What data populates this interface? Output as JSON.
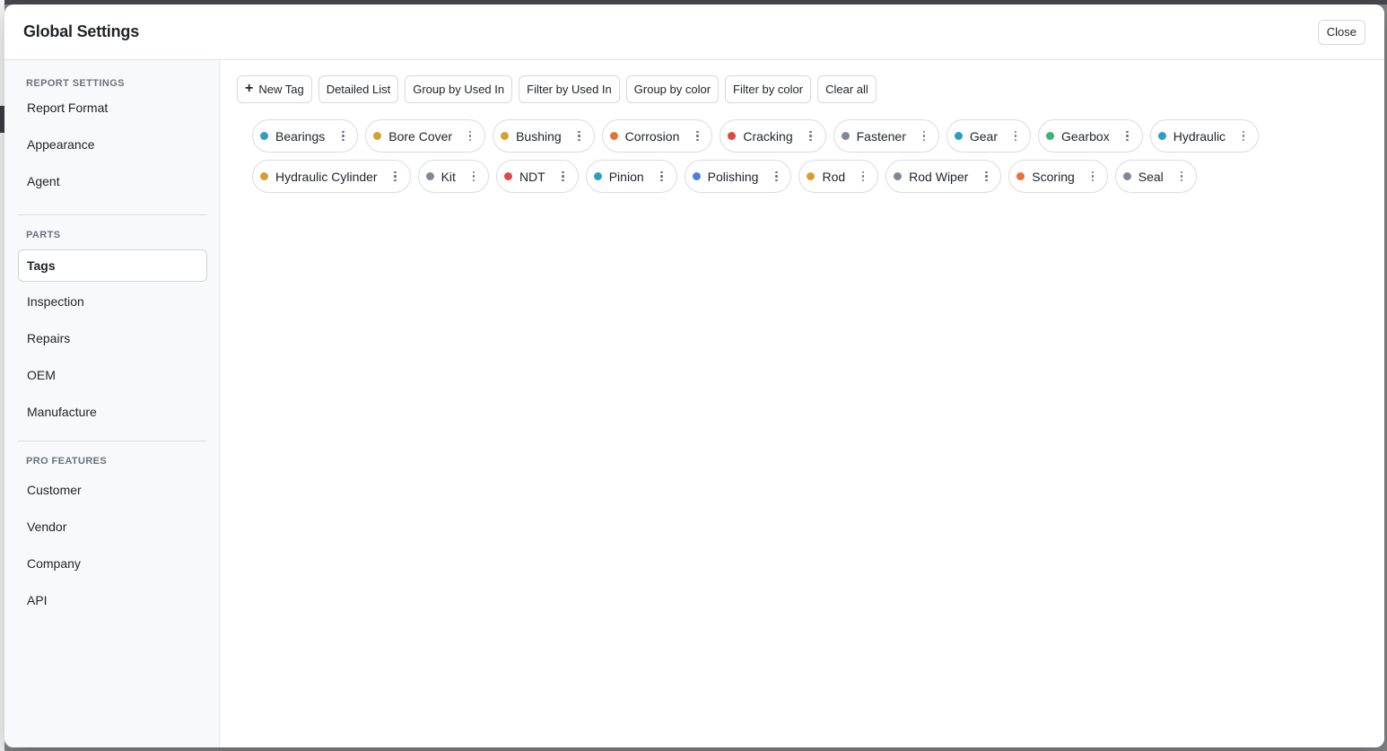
{
  "modal": {
    "title": "Global Settings",
    "close_label": "Close"
  },
  "sidebar": {
    "sections": [
      {
        "label": "REPORT SETTINGS",
        "items": [
          "Report Format",
          "Appearance",
          "Agent"
        ]
      },
      {
        "label": "PARTS",
        "items": [
          "Tags",
          "Inspection",
          "Repairs",
          "OEM",
          "Manufacture"
        ]
      },
      {
        "label": "PRO FEATURES",
        "items": [
          "Customer",
          "Vendor",
          "Company",
          "API"
        ]
      }
    ],
    "active_item": "Tags"
  },
  "toolbar": {
    "new_tag": "New Tag",
    "detailed_list": "Detailed List",
    "group_by_used_in": "Group by Used In",
    "filter_by_used_in": "Filter by Used In",
    "group_by_color": "Group by color",
    "filter_by_color": "Filter by color",
    "clear_all": "Clear all"
  },
  "tags": [
    {
      "label": "Bearings",
      "color": "#2e9fbd"
    },
    {
      "label": "Bore Cover",
      "color": "#d4a030"
    },
    {
      "label": "Bushing",
      "color": "#d4a030"
    },
    {
      "label": "Corrosion",
      "color": "#e8703a"
    },
    {
      "label": "Cracking",
      "color": "#e04848"
    },
    {
      "label": "Fastener",
      "color": "#808894"
    },
    {
      "label": "Gear",
      "color": "#2e9fbd"
    },
    {
      "label": "Gearbox",
      "color": "#3cb371"
    },
    {
      "label": "Hydraulic",
      "color": "#2e9fbd"
    },
    {
      "label": "Hydraulic Cylinder",
      "color": "#d4a030"
    },
    {
      "label": "Kit",
      "color": "#808894"
    },
    {
      "label": "NDT",
      "color": "#e04848"
    },
    {
      "label": "Pinion",
      "color": "#2e9fbd"
    },
    {
      "label": "Polishing",
      "color": "#4a80e0"
    },
    {
      "label": "Rod",
      "color": "#d4a030"
    },
    {
      "label": "Rod Wiper",
      "color": "#808894"
    },
    {
      "label": "Scoring",
      "color": "#e8703a"
    },
    {
      "label": "Seal",
      "color": "#808894"
    }
  ]
}
